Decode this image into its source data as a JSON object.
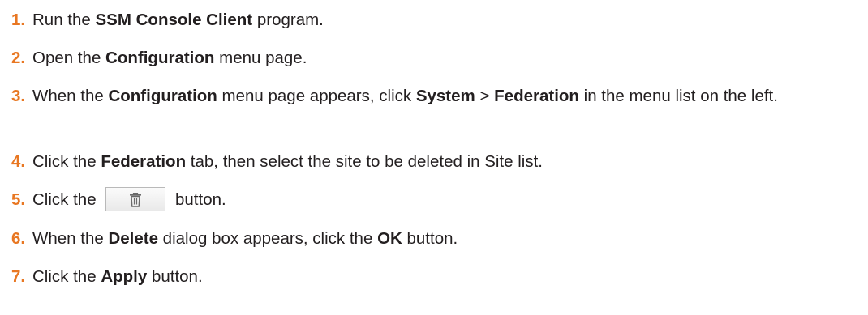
{
  "steps": [
    {
      "num": "1.",
      "parts": [
        "Run the ",
        "SSM Console Client",
        " program."
      ]
    },
    {
      "num": "2.",
      "parts": [
        "Open the ",
        "Configuration",
        " menu page."
      ]
    },
    {
      "num": "3.",
      "parts": [
        "When the ",
        "Configuration",
        " menu page appears, click ",
        "System",
        " > ",
        "Federation",
        " in the menu list on the left."
      ]
    },
    {
      "num": "4.",
      "parts": [
        "Click the ",
        "Federation",
        " tab, then select the site to be deleted in Site list."
      ]
    },
    {
      "num": "5.",
      "parts": [
        "Click the ",
        " button."
      ],
      "icon": "trash-icon"
    },
    {
      "num": "6.",
      "parts": [
        "When the ",
        "Delete",
        " dialog box appears, click the ",
        "OK",
        " button."
      ]
    },
    {
      "num": "7.",
      "parts": [
        "Click the ",
        "Apply",
        " button."
      ]
    }
  ],
  "colors": {
    "step_number": "#e87722",
    "text": "#231f20"
  }
}
